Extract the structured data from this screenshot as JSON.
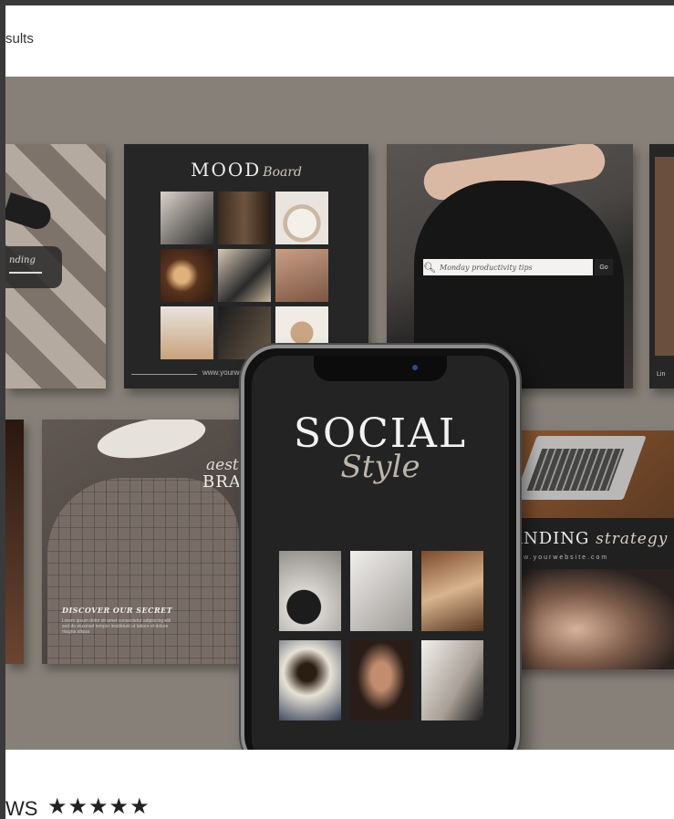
{
  "header": {
    "results_text": "sults"
  },
  "hero": {
    "moodboard": {
      "title": "MOOD",
      "title_script": "Board",
      "website": "www.yourwebsite.com"
    },
    "left_card": {
      "label": "nding"
    },
    "search_card": {
      "placeholder": "Monday productivity tips",
      "go_label": "Go",
      "search_icon": "search-icon"
    },
    "right_edge_card": {
      "label": "Lin"
    },
    "brand_card": {
      "script": "aesthetic",
      "title": "BRAND",
      "heading": "DISCOVER OUR SECRET",
      "body": "Lorem ipsum dolor sit amet consectetur adipiscing elit sed do eiusmod tempor incididunt ut labore et dolore magna aliqua"
    },
    "strategy_card": {
      "title": "ANDING",
      "script": "strategy",
      "url": "www.yourwebsite.com"
    },
    "phone": {
      "title": "SOCIAL",
      "script": "Style"
    }
  },
  "footer": {
    "reviews_label": "WS",
    "stars": "★★★★★",
    "rating": 5
  }
}
